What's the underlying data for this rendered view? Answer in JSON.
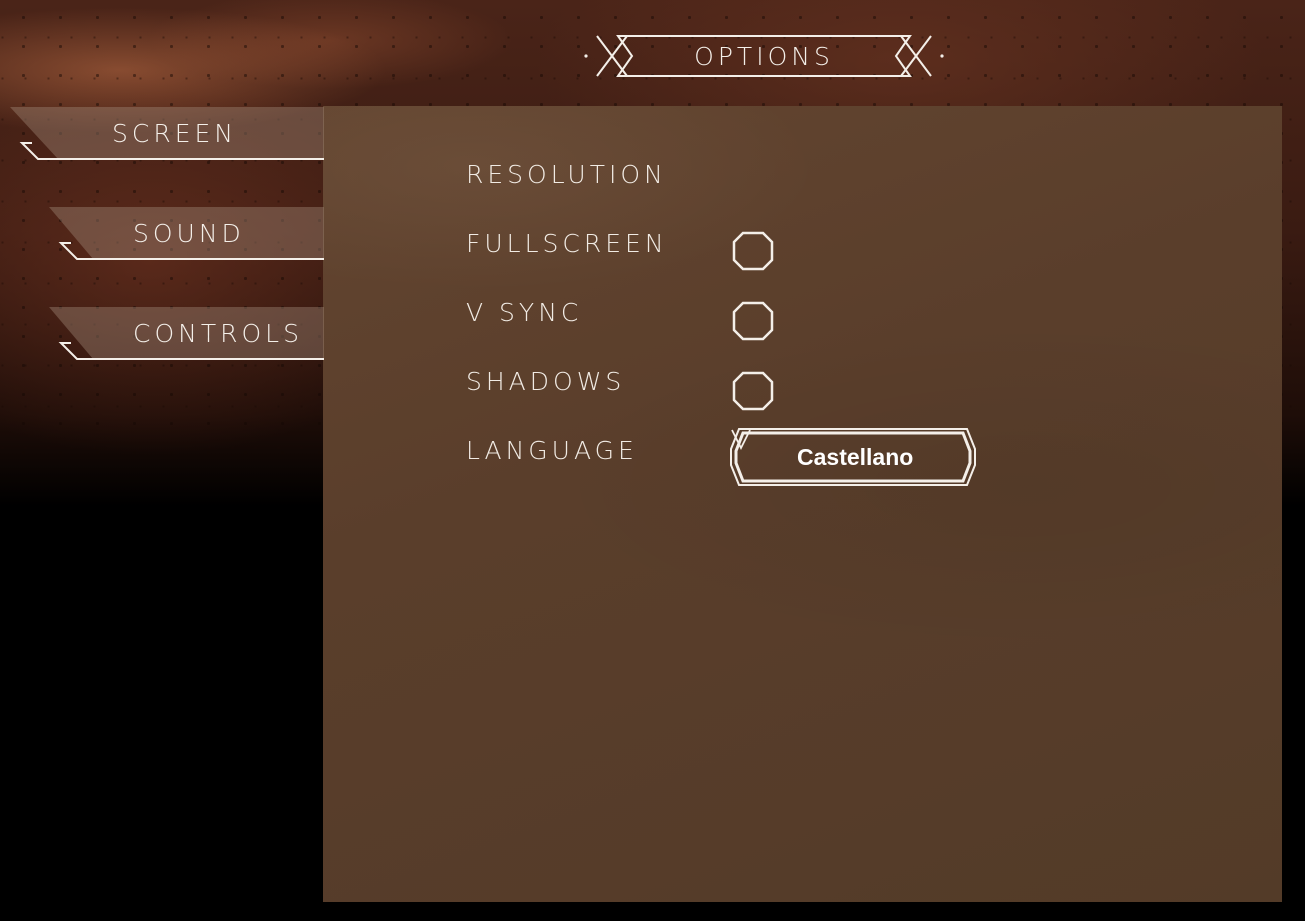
{
  "title": "Options",
  "tabs": [
    {
      "label": "Screen"
    },
    {
      "label": "Sound"
    },
    {
      "label": "Controls"
    }
  ],
  "screen_options": {
    "resolution": {
      "label": "Resolution"
    },
    "fullscreen": {
      "label": "Fullscreen",
      "checked": false
    },
    "vsync": {
      "label": "V Sync",
      "checked": false
    },
    "shadows": {
      "label": "Shadows",
      "checked": false
    },
    "language": {
      "label": "Language",
      "selected": "Castellano"
    }
  },
  "colors": {
    "panel": "#5a3e2b",
    "outline": "#f4efe9",
    "background_top": "#4a2418",
    "background_bottom": "#000000"
  },
  "icons": {
    "dropdown": "chevron-down-icon",
    "toggle": "octagon-toggle-icon"
  }
}
